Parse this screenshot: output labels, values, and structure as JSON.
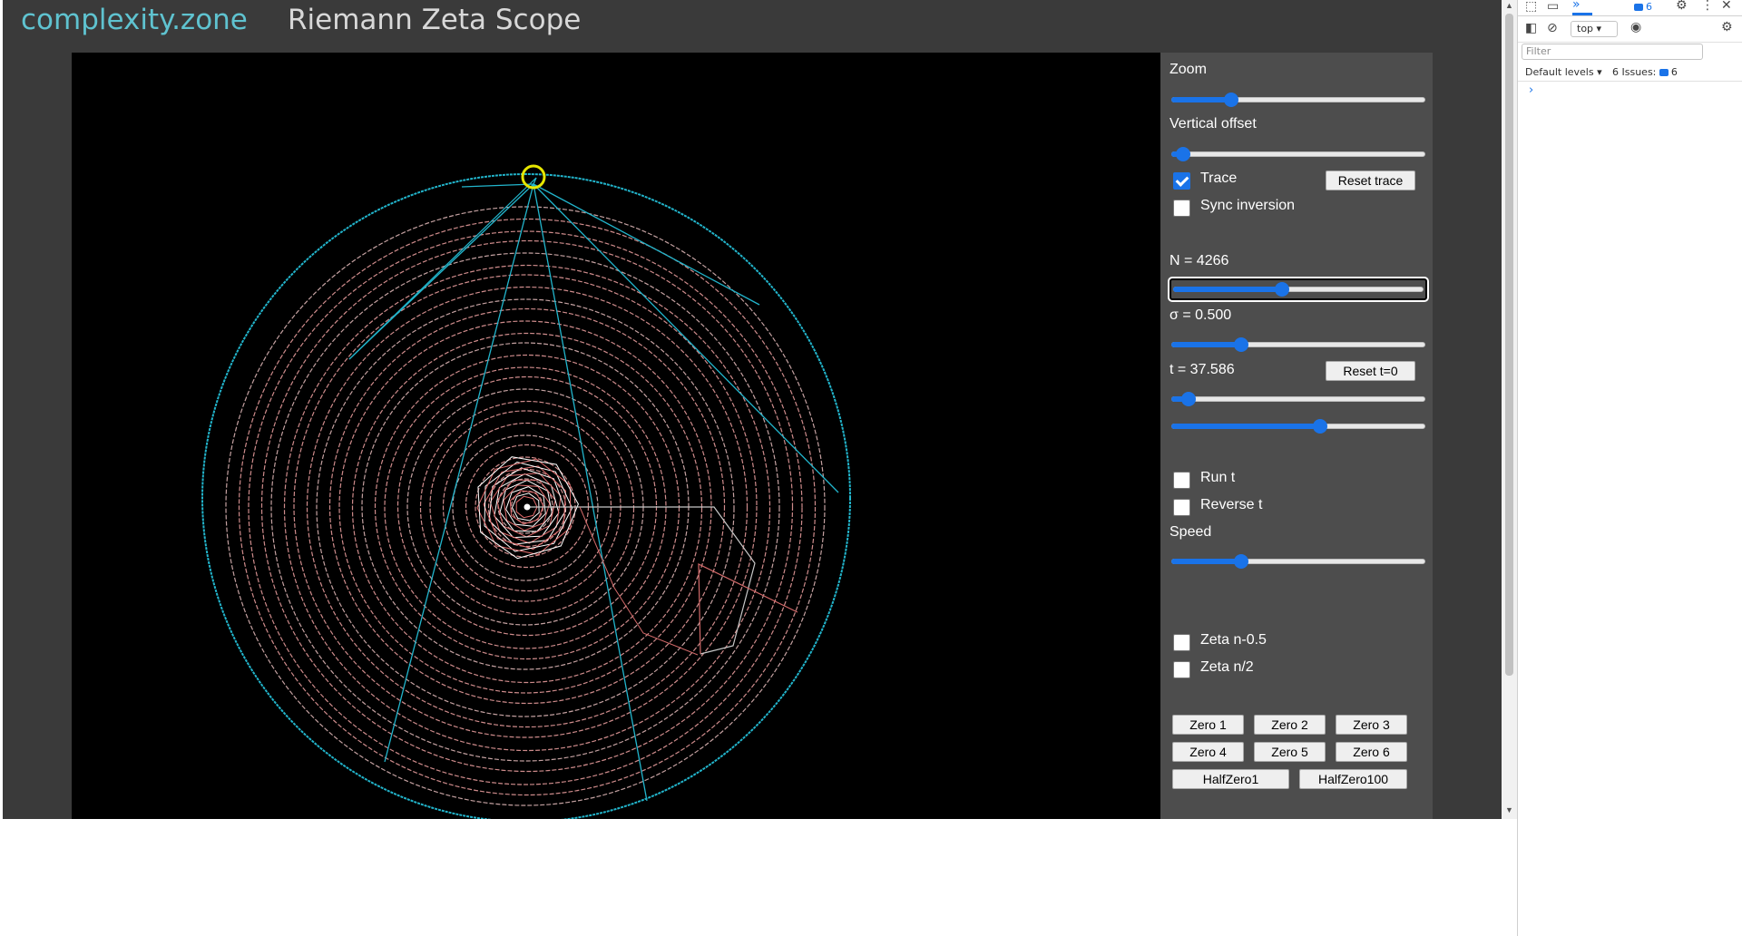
{
  "header": {
    "site_name": "complexity.zone",
    "title": "Riemann Zeta Scope"
  },
  "controls": {
    "zoom": {
      "label": "Zoom",
      "value": 0.22
    },
    "vertical_offset": {
      "label": "Vertical offset",
      "value": 0.02
    },
    "trace": {
      "label": "Trace",
      "checked": true
    },
    "reset_trace": {
      "label": "Reset trace"
    },
    "sync_inversion": {
      "label": "Sync inversion",
      "checked": false
    },
    "n": {
      "label": "N = 4266",
      "value": 0.44
    },
    "sigma": {
      "label": "σ = 0.500",
      "value": 0.26
    },
    "t": {
      "label": "t = 37.586",
      "value": 0.04
    },
    "reset_t": {
      "label": "Reset t=0"
    },
    "t_fine": {
      "value": 0.59
    },
    "run_t": {
      "label": "Run t",
      "checked": false
    },
    "reverse_t": {
      "label": "Reverse t",
      "checked": false
    },
    "speed": {
      "label": "Speed",
      "value": 0.26
    },
    "zeta_n_half_minus": {
      "label": "Zeta n-0.5",
      "checked": false
    },
    "zeta_n_over_2": {
      "label": "Zeta n/2",
      "checked": false
    },
    "zero_buttons": [
      "Zero 1",
      "Zero 2",
      "Zero 3",
      "Zero 4",
      "Zero 5",
      "Zero 6"
    ],
    "half_zero_buttons": [
      "HalfZero1",
      "HalfZero100"
    ]
  },
  "devtools": {
    "issues_count_tab": "6",
    "context": "top",
    "filter_placeholder": "Filter",
    "levels": "Default levels",
    "issues_label": "6 Issues:",
    "issues_count": "6",
    "prompt": "›"
  },
  "colors": {
    "site_name": "#5fc3d0",
    "outer_circle": "#22b5cc",
    "inner_rings": "#e49a9a",
    "trace_marker": "#e6e600",
    "slider_accent": "#1a73e8"
  }
}
